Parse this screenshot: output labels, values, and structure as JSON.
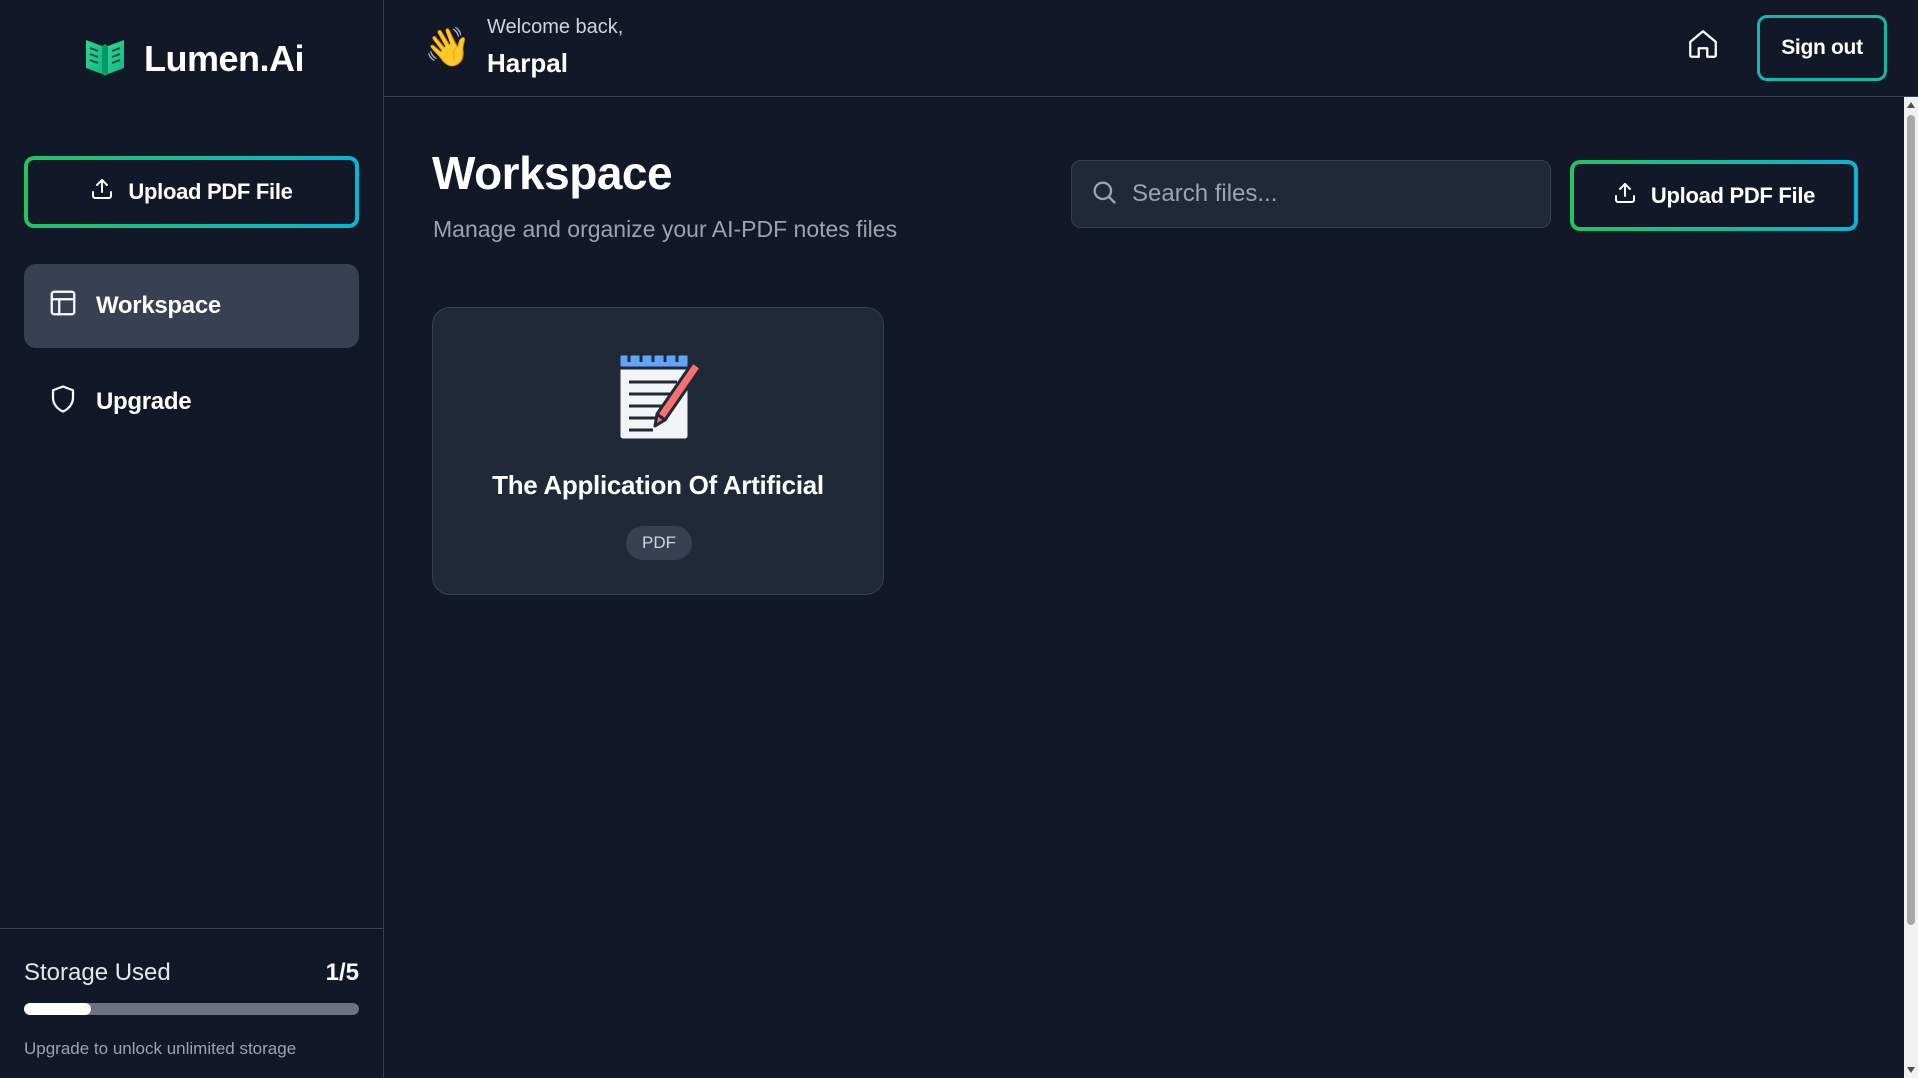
{
  "app": {
    "name": "Lumen.Ai",
    "accent_gradient": [
      "#22c55e",
      "#06b6d4"
    ],
    "logo_icon": "open-book-icon"
  },
  "sidebar": {
    "upload_label": "Upload PDF File",
    "items": [
      {
        "label": "Workspace",
        "icon": "layout-icon",
        "active": true
      },
      {
        "label": "Upgrade",
        "icon": "shield-icon",
        "active": false
      }
    ],
    "storage": {
      "label": "Storage Used",
      "count": "1/5",
      "progress_fraction": 0.2,
      "hint": "Upgrade to unlock unlimited storage"
    }
  },
  "header": {
    "wave_emoji": "👋",
    "welcome_text": "Welcome back,",
    "username": "Harpal",
    "home_icon": "home-icon",
    "signout_label": "Sign out"
  },
  "main": {
    "title": "Workspace",
    "subtitle": "Manage and organize your AI-PDF notes files",
    "search": {
      "placeholder": "Search files...",
      "value": ""
    },
    "upload_label": "Upload PDF File",
    "files": [
      {
        "title": "The Application Of Artificial",
        "badge": "PDF",
        "icon": "notepad-pencil-icon"
      }
    ]
  }
}
